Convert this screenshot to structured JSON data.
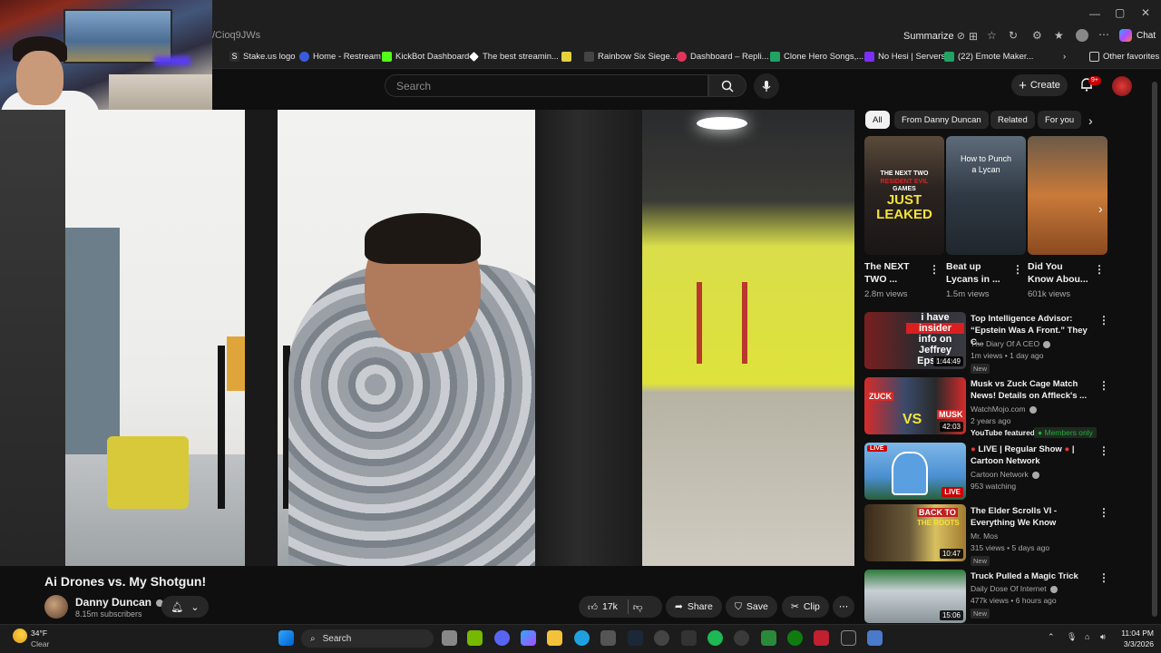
{
  "browser": {
    "url_fragment": "/Cioq9JWs",
    "summarize_label": "Summarize",
    "chat_label": "Chat",
    "bookmarks": [
      {
        "label": "Stake.us logo",
        "color": "#2d2d2d"
      },
      {
        "label": "Home - Restream",
        "color": "#3b5bdb"
      },
      {
        "label": "KickBot Dashboard",
        "color": "#53fc18"
      },
      {
        "label": "The best streamin...",
        "color": "#ffffff"
      },
      {
        "label": "",
        "color": "#e6d23a"
      },
      {
        "label": "Rainbow Six Siege...",
        "color": "#888888"
      },
      {
        "label": "Dashboard – Repli...",
        "color": "#e0345a"
      },
      {
        "label": "Clone Hero Songs,...",
        "color": "#1fa463"
      },
      {
        "label": "No Hesi | Servers",
        "color": "#7b2ff7"
      },
      {
        "label": "(22) Emote Maker...",
        "color": "#1fa463"
      }
    ],
    "other_favorites": "Other favorites"
  },
  "youtube": {
    "search_placeholder": "Search",
    "create_label": "Create",
    "notifications_badge": "9+"
  },
  "video": {
    "title": "Ai Drones vs. My Shotgun!",
    "channel": "Danny Duncan",
    "subscribers": "8.15m subscribers",
    "likes": "17k",
    "share_label": "Share",
    "save_label": "Save",
    "clip_label": "Clip"
  },
  "sidebar": {
    "chips": [
      "All",
      "From Danny Duncan",
      "Related",
      "For you"
    ],
    "shorts": [
      {
        "title": "The NEXT TWO ...",
        "views": "2.8m views",
        "overlay": [
          "THE NEXT TWO",
          "RESIDENT EVIL",
          "GAMES",
          "JUST",
          "LEAKED"
        ]
      },
      {
        "title": "Beat up Lycans in ...",
        "views": "1.5m views",
        "overlay": [
          "How to Punch",
          "a Lycan"
        ]
      },
      {
        "title": "Did You Know Abou...",
        "views": "601k views",
        "overlay": []
      }
    ],
    "recommendations": [
      {
        "title": "Top Intelligence Advisor: “Epstein Was A Front.” They C...",
        "channel": "The Diary Of A CEO",
        "meta": "1m views • 1 day ago",
        "badge": "New",
        "duration": "1:44:49",
        "thumb_text": [
          "i have",
          "insider",
          "info on",
          "Jeffrey",
          "Epstein"
        ],
        "live": false
      },
      {
        "title": "Musk vs Zuck Cage Match News! Details on Affleck's ...",
        "channel": "WatchMojo.com",
        "meta": "2 years ago",
        "badge": "",
        "extra": "YouTube featured",
        "members": "Members only",
        "duration": "42:03",
        "thumb_text": [
          "ZUCK",
          "VS",
          "MUSK"
        ],
        "live": false
      },
      {
        "title": "LIVE | Regular Show",
        "title2": "Cartoon Network",
        "channel": "Cartoon Network",
        "meta": "953 watching",
        "badge": "",
        "duration": "LIVE",
        "thumb_text": [
          "LIVE"
        ],
        "live": true
      },
      {
        "title": "The Elder Scrolls VI - Everything We Know",
        "channel": "Mr. Mos",
        "meta": "315 views • 5 days ago",
        "badge": "New",
        "duration": "10:47",
        "thumb_text": [
          "BACK TO",
          "THE ROOTS"
        ],
        "live": false
      },
      {
        "title": "Truck Pulled a Magic Trick",
        "channel": "Daily Dose Of Internet",
        "meta": "477k views • 6 hours ago",
        "badge": "New",
        "duration": "15:06",
        "thumb_text": [],
        "live": false
      }
    ]
  },
  "taskbar": {
    "weather_temp": "34°F",
    "weather_desc": "Clear",
    "search_label": "Search",
    "time": "11:04 PM",
    "date": "3/3/2026"
  }
}
